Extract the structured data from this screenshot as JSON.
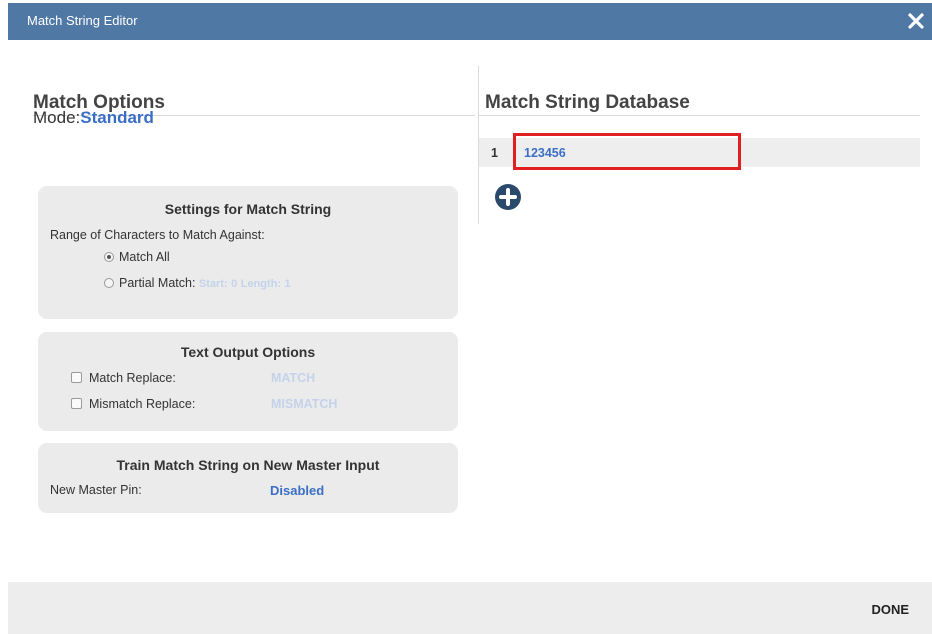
{
  "window": {
    "title": "Match String Editor",
    "close_icon": "close-icon"
  },
  "match_options": {
    "heading": "Match Options",
    "mode_label": "Mode:",
    "mode_value": "Standard",
    "settings": {
      "title": "Settings for Match String",
      "range_label": "Range of Characters to Match Against:",
      "option_all": "Match All",
      "option_partial": "Partial Match:",
      "start_label": "Start:",
      "start_value": "0",
      "length_label": "Length:",
      "length_value": "1",
      "selected": "Match All"
    },
    "text_output": {
      "title": "Text Output Options",
      "match_replace_label": "Match Replace:",
      "match_replace_value": "MATCH",
      "mismatch_replace_label": "Mismatch Replace:",
      "mismatch_replace_value": "MISMATCH"
    },
    "train": {
      "title": "Train Match String on New Master Input",
      "pin_label": "New Master Pin:",
      "pin_value": "Disabled"
    }
  },
  "database": {
    "heading": "Match String Database",
    "rows": [
      {
        "index": "1",
        "value": "123456"
      }
    ],
    "add_icon": "plus-circle-icon"
  },
  "footer": {
    "done_label": "DONE"
  },
  "colors": {
    "titlebar": "#4f78a5",
    "accent": "#3b6fc6",
    "highlight": "#e02020"
  }
}
